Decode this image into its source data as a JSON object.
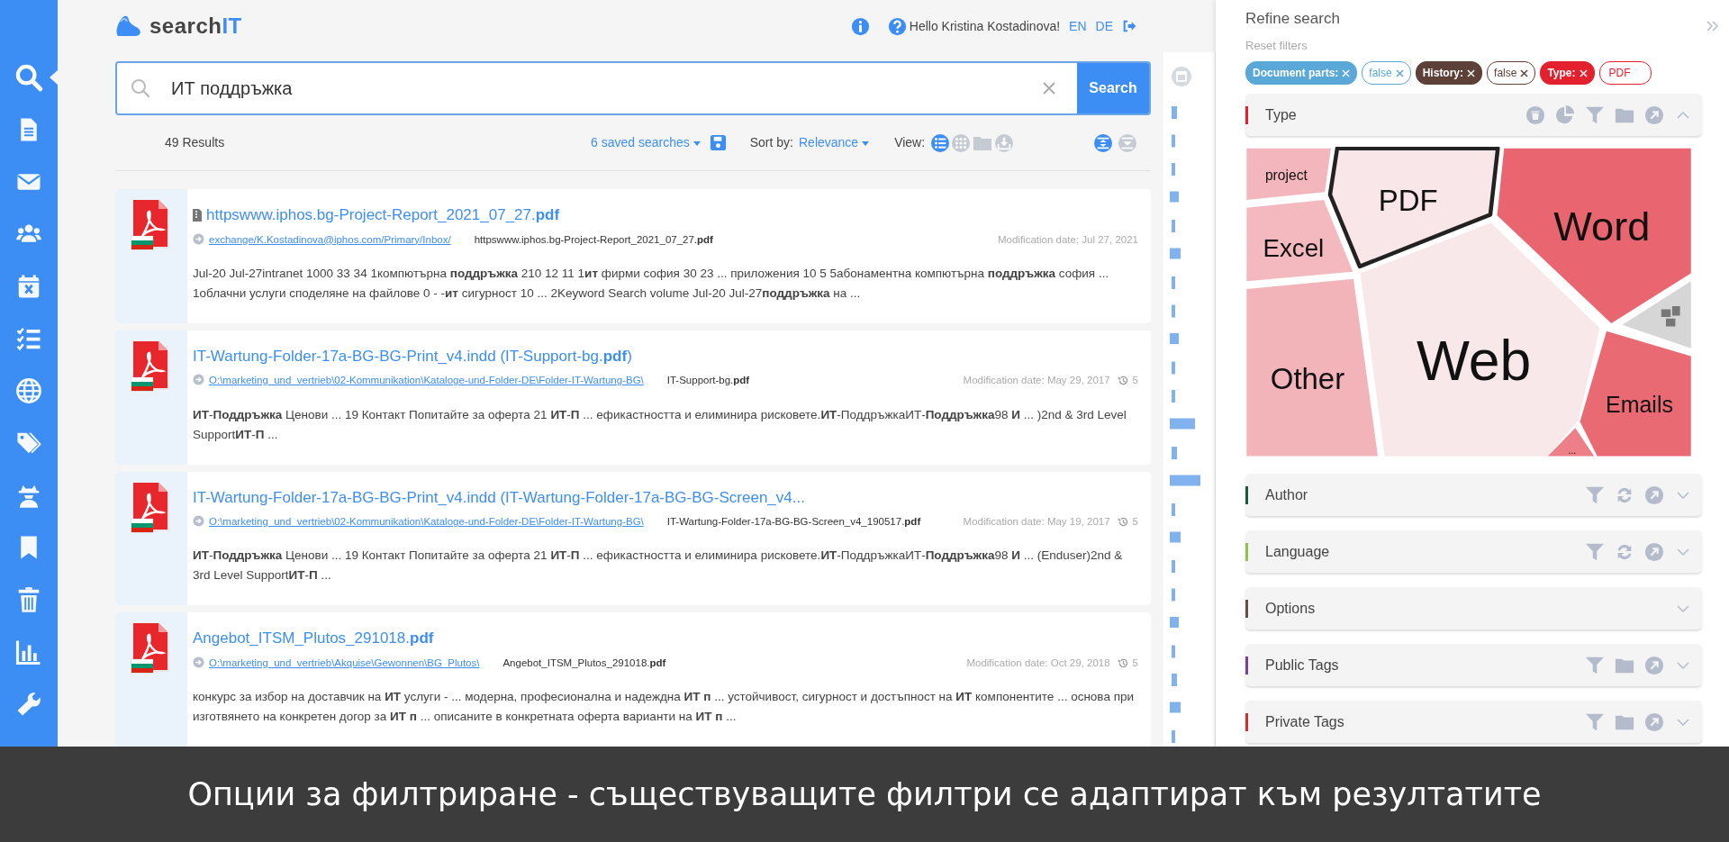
{
  "sidebar": {
    "items": [
      {
        "kind": "search",
        "selected": true
      },
      {
        "kind": "document",
        "selected": false
      },
      {
        "kind": "mail",
        "selected": false
      },
      {
        "kind": "users",
        "selected": false
      },
      {
        "kind": "calendar",
        "selected": false
      },
      {
        "kind": "checklist",
        "selected": false
      },
      {
        "kind": "globe",
        "selected": false
      },
      {
        "kind": "tags",
        "selected": false
      },
      {
        "kind": "detective",
        "selected": false
      },
      {
        "kind": "bookmark",
        "selected": false
      },
      {
        "kind": "trash",
        "selected": false
      },
      {
        "kind": "chart",
        "selected": false
      },
      {
        "kind": "wrench",
        "selected": false
      }
    ]
  },
  "header": {
    "logo": {
      "prefix": "search",
      "suffix": "IT"
    },
    "greeting": "Hello Kristina Kostadinova!",
    "languages": [
      "EN",
      "DE"
    ]
  },
  "search": {
    "query": "ИТ поддръжка",
    "button": "Search"
  },
  "toolbar": {
    "results_count": "49 Results",
    "saved_searches": "6 saved searches",
    "sort_label": "Sort by:",
    "sort_value": "Relevance",
    "view_label": "View:",
    "views": [
      {
        "kind": "list",
        "selected": true
      },
      {
        "kind": "grid",
        "selected": false
      },
      {
        "kind": "folder",
        "selected": false
      },
      {
        "kind": "download",
        "selected": false
      }
    ],
    "layout_toggles": [
      {
        "kind": "expand",
        "selected": true
      },
      {
        "kind": "collapse",
        "selected": false
      }
    ]
  },
  "results": [
    {
      "title": "httpswww.iphos.bg-Project-Report_2021_07_27.**pdf**",
      "attachment": true,
      "path": "exchange/K.Kostadinova@iphos.com/Primary/Inbox/",
      "filename": "httpswww.iphos.bg-Project-Report_2021_07_27.**pdf**",
      "date": "Modification date: Jul 27, 2021",
      "snippet": "Jul-20 Jul-27intranet 1000 33 34 1компютърна **поддръжка** 210 12 11 1**ит** фирми софия 30 23 ... приложения 10 5 5абонаментна компютърна **поддръжка** софия ... 1облачни услуги споделяне на файлове 0 - -**ит** сигурност 10 ... 2Keyword Search volume Jul-20 Jul-27**поддръжка** на ..."
    },
    {
      "title": "IT-Wartung-Folder-17a-BG-BG-Print_v4.indd (IT-Support-bg.**pdf**)",
      "attachment": false,
      "path": "O:\\marketing_und_vertrieb\\02-Kommunikation\\Kataloge-und-Folder-DE\\Folder-IT-Wartung-BG\\",
      "filename": "IT-Support-bg.**pdf**",
      "date": "Modification date: May 29, 2017",
      "versions": "5",
      "snippet": "**ИТ**-**Поддръжка** Ценови ... 19 Контакт Попитайте за оферта 21 **ИТ**-**П** ... ефикастността и елиминира рисковете.**ИТ**-ПоддръжкаИТ-**Поддръжка**98 **И** ... )2nd & 3rd Level Support**ИТ**-**П** ..."
    },
    {
      "title": "IT-Wartung-Folder-17a-BG-BG-Print_v4.indd (IT-Wartung-Folder-17a-BG-BG-Screen_v4...",
      "attachment": false,
      "path": "O:\\marketing_und_vertrieb\\02-Kommunikation\\Kataloge-und-Folder-DE\\Folder-IT-Wartung-BG\\",
      "filename": "IT-Wartung-Folder-17a-BG-BG-Screen_v4_190517.**pdf**",
      "date": "Modification date: May 19, 2017",
      "versions": "5",
      "snippet": "**ИТ**-**Поддръжка** Ценови ... 19 Контакт Попитайте за оферта 21 **ИТ**-**П** ... ефикастността и елиминира рисковете.**ИТ**-ПоддръжкаИТ-**Поддръжка**98 **И** ... (Enduser)2nd & 3rd Level Support**ИТ**-**П** ..."
    },
    {
      "title": "Angebot_ITSM_Plutos_291018.**pdf**",
      "attachment": false,
      "path": "O:\\marketing_und_vertrieb\\Akquise\\Gewonnen\\BG_Plutos\\",
      "filename": "Angebot_ITSM_Plutos_291018.**pdf**",
      "date": "Modification date: Oct 29, 2018",
      "versions": "5",
      "snippet": "конкурс за избор на доставчик на **ИТ** услуги - ... модерна, професионална и надеждна **ИТ** **п** ... устойчивост, сигурност и достъпност на **ИТ** компонентите ... основа при изготвянето на конкретен догор за **ИТ** **п** ... описаните в конкретната оферта варианти на **ИТ** **п** ..."
    }
  ],
  "refine": {
    "title": "Refine search",
    "reset": "Reset filters",
    "chips": [
      {
        "label": "Document parts:",
        "kind": "name",
        "color": "#59a8d8",
        "removable": true
      },
      {
        "label": "false",
        "kind": "value",
        "color": "#59a8d8",
        "removable": true
      },
      {
        "label": "History:",
        "kind": "name",
        "color": "#5d4037",
        "removable": true
      },
      {
        "label": "false",
        "kind": "value",
        "color": "#5d4037",
        "removable": true
      },
      {
        "label": "Type:",
        "kind": "name",
        "color": "#e3202d",
        "removable": true
      },
      {
        "label": "PDF",
        "kind": "value",
        "color": "#e3202d",
        "removable": false
      }
    ],
    "facets": [
      {
        "title": "Type",
        "color": "#e3202d",
        "expanded": true,
        "tools": [
          {
            "kind": "delete"
          },
          {
            "kind": "pie"
          },
          {
            "kind": "filter"
          },
          {
            "kind": "folder"
          },
          {
            "kind": "open"
          }
        ],
        "treemap": {
          "cells": [
            {
              "label": "project",
              "color": "#f3b6bc",
              "selected": false
            },
            {
              "label": "PDF",
              "color": "#f9e6e8",
              "selected": true
            },
            {
              "label": "Word",
              "color": "#e9656f",
              "selected": false
            },
            {
              "label": "Excel",
              "color": "#f3b9be",
              "selected": false
            },
            {
              "label": "Other",
              "color": "#f2b3b9",
              "selected": false
            },
            {
              "label": "Web",
              "color": "#f8e8ea",
              "selected": false
            },
            {
              "label": "Emails",
              "color": "#ea6a74",
              "selected": false
            },
            {
              "label": "...",
              "color": "#ec7f88",
              "selected": false
            }
          ]
        }
      },
      {
        "title": "Author",
        "color": "#1e5a36",
        "expanded": false,
        "tools": [
          {
            "kind": "filter"
          },
          {
            "kind": "sync"
          },
          {
            "kind": "open"
          }
        ]
      },
      {
        "title": "Language",
        "color": "#8bc34a",
        "expanded": false,
        "tools": [
          {
            "kind": "filter"
          },
          {
            "kind": "sync"
          },
          {
            "kind": "open"
          }
        ]
      },
      {
        "title": "Options",
        "color": "#6d4c41",
        "expanded": false
      },
      {
        "title": "Public Tags",
        "color": "#7b3f98",
        "expanded": false,
        "tools": [
          {
            "kind": "filter"
          },
          {
            "kind": "folder"
          },
          {
            "kind": "open"
          }
        ]
      },
      {
        "title": "Private Tags",
        "color": "#d32f2f",
        "expanded": false,
        "tools": [
          {
            "kind": "filter"
          },
          {
            "kind": "folder"
          },
          {
            "kind": "open"
          }
        ]
      }
    ]
  },
  "caption": "Опции за филтриране - съществуващите филтри се адаптират към резултатите"
}
